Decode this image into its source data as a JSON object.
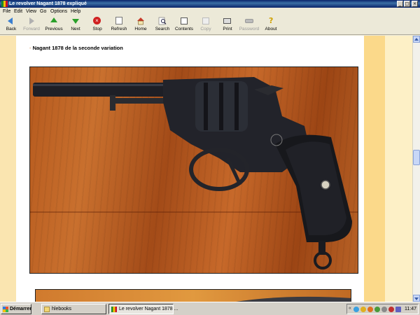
{
  "window": {
    "title": "Le revolver Nagant 1878 expliqué",
    "buttons": {
      "minimize": "_",
      "maximize": "□",
      "close": "×"
    }
  },
  "menu": [
    "File",
    "Edit",
    "View",
    "Go",
    "Options",
    "Help"
  ],
  "toolbar": [
    {
      "label": "Back",
      "icon": "back-arrow-icon",
      "enabled": true
    },
    {
      "label": "Forward",
      "icon": "forward-arrow-icon",
      "enabled": false
    },
    {
      "label": "Previous",
      "icon": "up-arrow-icon",
      "enabled": true
    },
    {
      "label": "Next",
      "icon": "down-arrow-icon",
      "enabled": true
    },
    {
      "label": "Stop",
      "icon": "stop-icon",
      "enabled": true
    },
    {
      "label": "Refresh",
      "icon": "refresh-icon",
      "enabled": true
    },
    {
      "label": "Home",
      "icon": "home-icon",
      "enabled": true
    },
    {
      "label": "Search",
      "icon": "search-icon",
      "enabled": true
    },
    {
      "label": "Contents",
      "icon": "contents-icon",
      "enabled": true
    },
    {
      "label": "Copy",
      "icon": "copy-icon",
      "enabled": false
    },
    {
      "label": "Print",
      "icon": "print-icon",
      "enabled": true
    },
    {
      "label": "Password",
      "icon": "password-icon",
      "enabled": false
    },
    {
      "label": "About",
      "icon": "about-icon",
      "enabled": true
    }
  ],
  "page": {
    "heading_dash": "-",
    "heading": "Nagant 1878 de la seconde variation"
  },
  "taskbar": {
    "start_label": "Démarrer",
    "tasks": [
      {
        "label": "hlebooks",
        "active": false
      },
      {
        "label": "Le revolver Nagant 1878 ...",
        "active": true
      }
    ],
    "tray_chevron": "«",
    "clock": "11:47"
  },
  "colors": {
    "title_bar": "#0a246a",
    "content_bg": "#ffffff",
    "left_margin": "#fae5b0",
    "right_band_1": "#fbd98a",
    "right_band_2": "#fdf0c6",
    "heading_dash": "#c87020"
  }
}
